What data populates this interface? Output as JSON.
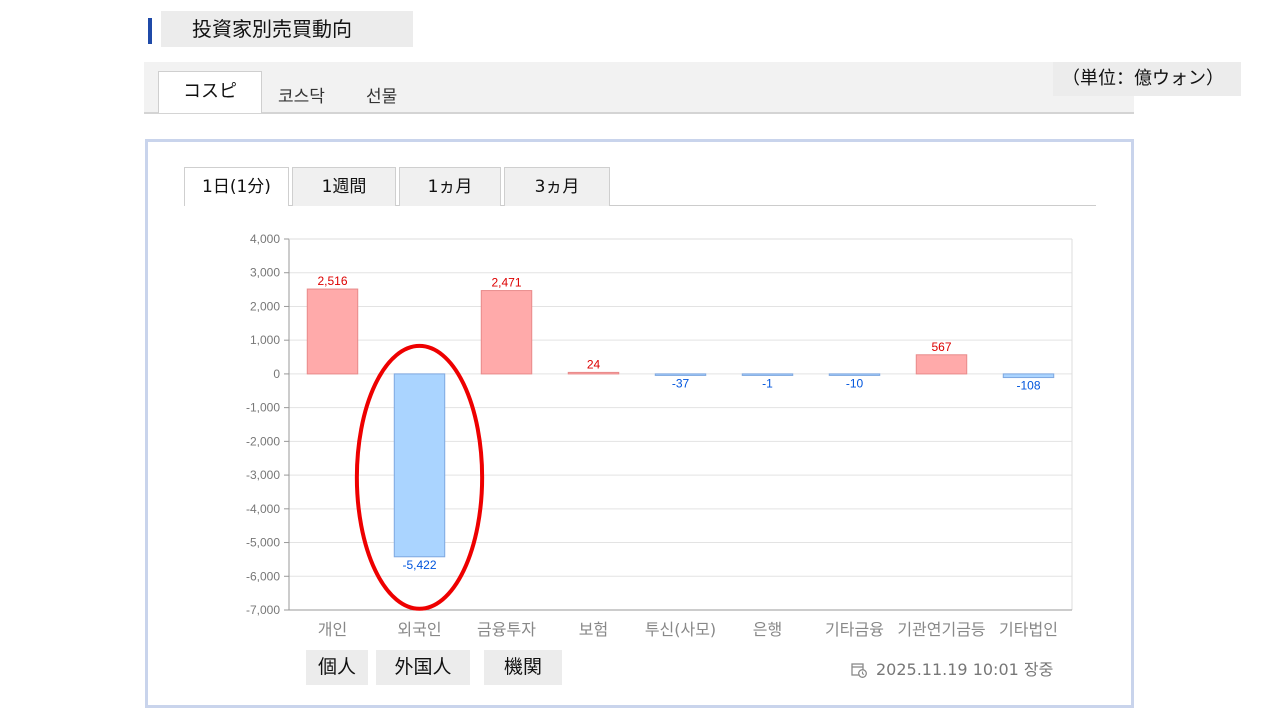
{
  "header": {
    "title": "投資家別売買動向"
  },
  "market_tabs": [
    {
      "label": "コスピ",
      "active": true
    },
    {
      "label": "코스닥",
      "active": false
    },
    {
      "label": "선물",
      "active": false
    }
  ],
  "unit_label": "（単位：億ウォン）",
  "period_tabs": [
    {
      "label": "1日(1分)",
      "active": true
    },
    {
      "label": "1週間",
      "active": false
    },
    {
      "label": "1ヵ月",
      "active": false
    },
    {
      "label": "3ヵ月",
      "active": false
    }
  ],
  "groups": {
    "individual": "個人",
    "foreign": "外国人",
    "institution": "機関"
  },
  "timestamp": "2025.11.19 10:01 장중",
  "icons": {
    "timestamp": "calendar-clock-icon"
  },
  "colors": {
    "positive_fill": "#ffaaaa",
    "positive_stroke": "#e88a8a",
    "positive_text": "#dd0000",
    "negative_fill": "#aad4ff",
    "negative_stroke": "#7fa8e0",
    "negative_text": "#0055dd",
    "highlight": "#ee0000"
  },
  "chart_data": {
    "type": "bar",
    "categories": [
      "개인",
      "외국인",
      "금융투자",
      "보험",
      "투신(사모)",
      "은행",
      "기타금융",
      "기관연기금등",
      "기타법인"
    ],
    "values": [
      2516,
      -5422,
      2471,
      24,
      -37,
      -1,
      -10,
      567,
      -108
    ],
    "data_labels": [
      "2,516",
      "-5,422",
      "2,471",
      "24",
      "-37",
      "-1",
      "-10",
      "567",
      "-108"
    ],
    "ylim": [
      -7000,
      4000
    ],
    "yticks": [
      "4,000",
      "3,000",
      "2,000",
      "1,000",
      "0",
      "-1,000",
      "-2,000",
      "-3,000",
      "-4,000",
      "-5,000",
      "-6,000",
      "-7,000"
    ],
    "grid": true,
    "highlighted_category": "외국인"
  }
}
